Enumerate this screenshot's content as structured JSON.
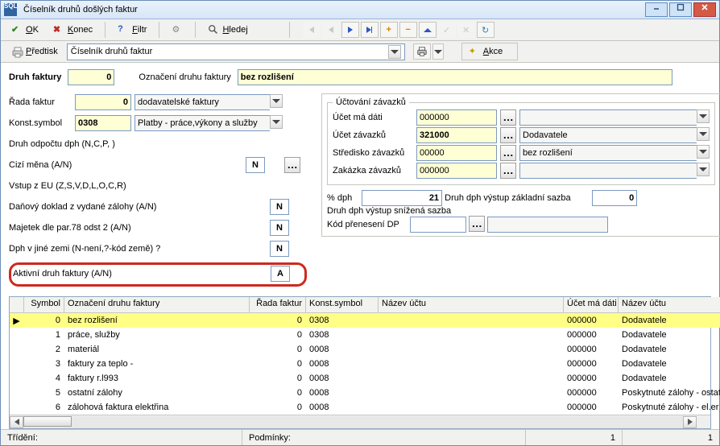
{
  "window": {
    "title": "Číselník druhů došlých faktur"
  },
  "toolbar1": {
    "ok": "OK",
    "konec": "Konec",
    "filtr": "Filtr",
    "hledej": "Hledej"
  },
  "toolbar2": {
    "predtisk": "Předtisk",
    "predtisk_combo": "Číselník druhů faktur",
    "akce": "Akce"
  },
  "form": {
    "druh_faktury_lbl": "Druh faktury",
    "druh_faktury_val": "0",
    "oznaceni_lbl": "Označení druhu faktury",
    "oznaceni_val": "bez rozlišení",
    "rada_lbl": "Řada faktur",
    "rada_val": "0",
    "rada_desc": "dodavatelské faktury",
    "konst_lbl": "Konst.symbol",
    "konst_val": "0308",
    "konst_desc": "Platby - práce,výkony a služby",
    "druh_odpoctu_lbl": "Druh odpočtu dph (N,C,P, )",
    "cizi_mena_lbl": "Cizí měna (A/N)",
    "cizi_mena_val": "N",
    "vstup_eu_lbl": "Vstup z EU  (Z,S,V,D,L,O,C,R)",
    "danovy_lbl": "Daňový doklad z vydané zálohy (A/N)",
    "danovy_val": "N",
    "majetek_lbl": "Majetek dle par.78 odst 2 (A/N)",
    "majetek_val": "N",
    "dph_jina_lbl": "Dph v jiné zemi (N-není,?-kód země) ?",
    "dph_jina_val": "N",
    "aktivni_lbl": "Aktivní druh faktury (A/N)",
    "aktivni_val": "A"
  },
  "right": {
    "legend": "Účtování závazků",
    "ucet_md_lbl": "Účet má dáti",
    "ucet_md_val": "000000",
    "ucet_zav_lbl": "Účet závazků",
    "ucet_zav_val": "321000",
    "ucet_zav_desc": "Dodavatele",
    "stred_lbl": "Středisko závazků",
    "stred_val": "00000",
    "stred_desc": "bez rozlišení",
    "zak_lbl": "Zakázka závazků",
    "zak_val": "000000",
    "pct_dph_lbl": "% dph",
    "pct_dph_val": "21",
    "druh_vystup_zakl_lbl": "Druh dph výstup základní sazba",
    "druh_vystup_zakl_val": "0",
    "druh_vystup_sniz_lbl": "Druh dph výstup snížená sazba",
    "kod_pren_lbl": "Kód přenesení DP"
  },
  "grid": {
    "headers": {
      "symbol": "Symbol",
      "oznaceni": "Označení druhu faktury",
      "rada": "Řada faktur",
      "konst": "Konst.symbol",
      "nazev_uctu": "Název účtu",
      "ucet_md": "Účet má dáti",
      "nazev_uctu2": "Název účtu"
    },
    "rows": [
      {
        "sym": "0",
        "ozn": "bez rozlišení",
        "rada": "0",
        "ks": "0308",
        "nazev": "",
        "umd": "000000",
        "nazev2": "Dodavatele"
      },
      {
        "sym": "1",
        "ozn": "práce, služby",
        "rada": "0",
        "ks": "0308",
        "nazev": "",
        "umd": "000000",
        "nazev2": "Dodavatele"
      },
      {
        "sym": "2",
        "ozn": "materiál",
        "rada": "0",
        "ks": "0008",
        "nazev": "",
        "umd": "000000",
        "nazev2": "Dodavatele"
      },
      {
        "sym": "3",
        "ozn": "faktury za teplo -",
        "rada": "0",
        "ks": "0008",
        "nazev": "",
        "umd": "000000",
        "nazev2": "Dodavatele"
      },
      {
        "sym": "4",
        "ozn": "faktury r.l993",
        "rada": "0",
        "ks": "0008",
        "nazev": "",
        "umd": "000000",
        "nazev2": "Dodavatele"
      },
      {
        "sym": "5",
        "ozn": "ostatní zálohy",
        "rada": "0",
        "ks": "0008",
        "nazev": "",
        "umd": "000000",
        "nazev2": "Poskytnuté zálohy - ostat"
      },
      {
        "sym": "6",
        "ozn": "zálohová faktura elektřina",
        "rada": "0",
        "ks": "0008",
        "nazev": "",
        "umd": "000000",
        "nazev2": "Poskytnuté zálohy - el.er"
      }
    ]
  },
  "status": {
    "trideni": "Třídění:",
    "podminky": "Podmínky:",
    "num1": "1",
    "num2": "1"
  }
}
